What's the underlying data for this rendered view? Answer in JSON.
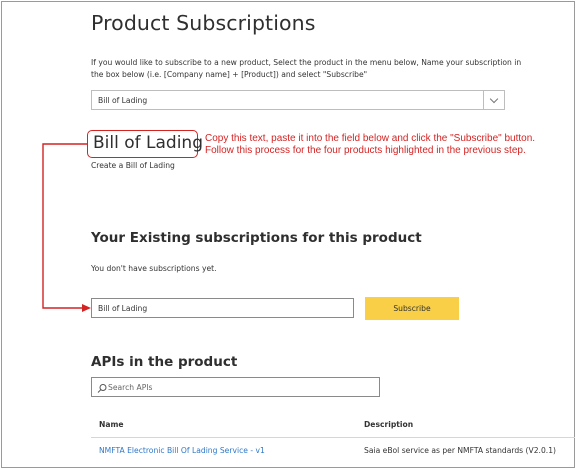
{
  "page": {
    "title": "Product Subscriptions",
    "intro": "If you would like to subscribe to a new product, Select the product in the menu below, Name your subscription in the box below (i.e. [Company name] + [Product]) and select \"Subscribe\""
  },
  "product_select": {
    "selected": "Bill of Lading"
  },
  "product": {
    "name": "Bill of Lading",
    "description": "Create a Bill of Lading"
  },
  "annotation": {
    "text": "Copy this text, paste it into the field below and click the \"Subscribe\" button. Follow this process for the four products highlighted in the previous step.",
    "color": "#d42323"
  },
  "existing": {
    "title": "Your Existing subscriptions for this product",
    "empty_message": "You don't have subscriptions yet.",
    "input_value": "Bill of Lading",
    "subscribe_label": "Subscribe",
    "button_color": "#f8cf46"
  },
  "apis": {
    "title": "APIs in the product",
    "search_placeholder": "Search APIs",
    "columns": [
      "Name",
      "Description"
    ],
    "rows": [
      {
        "name": "NMFTA Electronic Bill Of Lading Service - v1",
        "description": "Saia eBol service as per NMFTA standards (V2.0.1)"
      }
    ],
    "link_color": "#2e78c7"
  }
}
